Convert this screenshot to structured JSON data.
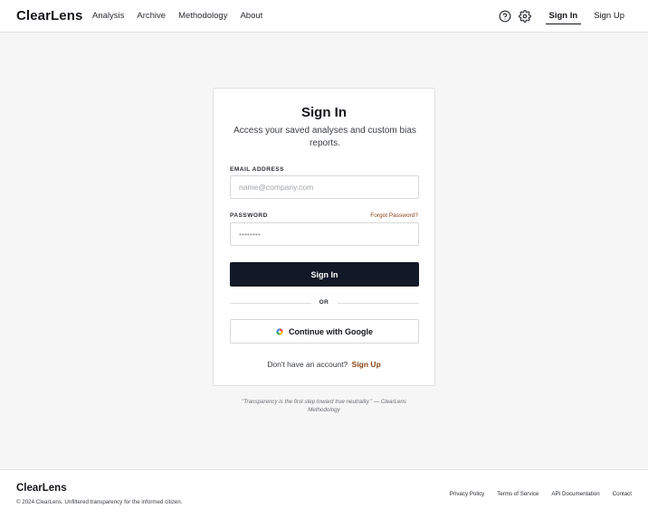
{
  "header": {
    "logo": "ClearLens",
    "nav": [
      "Analysis",
      "Archive",
      "Methodology",
      "About"
    ],
    "help_icon": "help-circle-icon",
    "settings_icon": "gear-icon",
    "sign_in": "Sign In",
    "sign_up": "Sign Up"
  },
  "card": {
    "title": "Sign In",
    "subtitle": "Access your saved analyses and custom bias reports.",
    "email_label": "EMAIL ADDRESS",
    "email_placeholder": "name@company.com",
    "password_label": "PASSWORD",
    "forgot_link": "Forgot Password?",
    "password_placeholder": "••••••••",
    "submit_label": "Sign In",
    "divider": "OR",
    "google_label": "Continue with Google",
    "signup_prompt": "Don't have an account?",
    "signup_link": "Sign Up"
  },
  "quote": "\"Transparency is the first step toward true neutrality.\" — ClearLens Methodology",
  "footer": {
    "logo": "ClearLens",
    "copyright": "© 2024 ClearLens. Unfiltered transparency for the informed citizen.",
    "links": [
      "Privacy Policy",
      "Terms of Service",
      "API Documentation",
      "Contact"
    ]
  },
  "colors": {
    "accent": "#8a4316",
    "primary_button": "#111827",
    "background": "#f6f6f6"
  }
}
